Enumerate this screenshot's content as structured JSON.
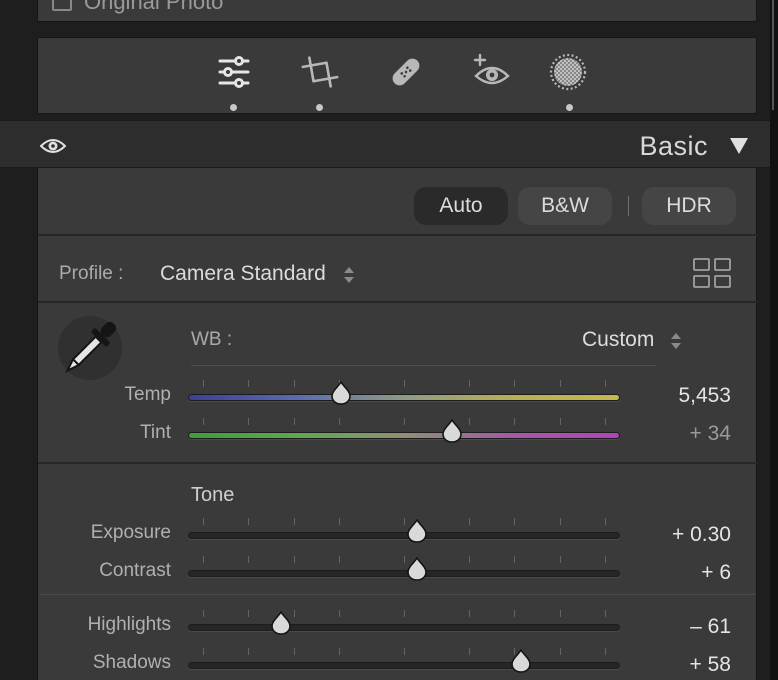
{
  "top_strip": {
    "original_photo_label": "Original Photo"
  },
  "tools": [
    {
      "icon": "edit-sliders-icon",
      "active": true
    },
    {
      "icon": "crop-icon",
      "active": true
    },
    {
      "icon": "healing-bandage-icon",
      "active": false
    },
    {
      "icon": "red-eye-icon",
      "active": false
    },
    {
      "icon": "masking-icon",
      "active": true
    }
  ],
  "panel": {
    "title": "Basic"
  },
  "treatment": {
    "auto": "Auto",
    "bw": "B&W",
    "hdr": "HDR"
  },
  "profile": {
    "label": "Profile :",
    "value": "Camera Standard"
  },
  "wb": {
    "label": "WB :",
    "value": "Custom"
  },
  "tone": {
    "label": "Tone"
  },
  "sliders": {
    "temp": {
      "label": "Temp",
      "value": "5,453",
      "position": 0.355
    },
    "tint": {
      "label": "Tint",
      "value": "+ 34",
      "position": 0.61
    },
    "exposure": {
      "label": "Exposure",
      "value": "+ 0.30",
      "position": 0.53
    },
    "contrast": {
      "label": "Contrast",
      "value": "+ 6",
      "position": 0.53
    },
    "highlights": {
      "label": "Highlights",
      "value": "– 61",
      "position": 0.215
    },
    "shadows": {
      "label": "Shadows",
      "value": "+ 58",
      "position": 0.77
    }
  },
  "colors": {
    "panel_bg": "#3a3a3a",
    "header_bg": "#2d2d2d",
    "text": "#d4d4d4"
  }
}
